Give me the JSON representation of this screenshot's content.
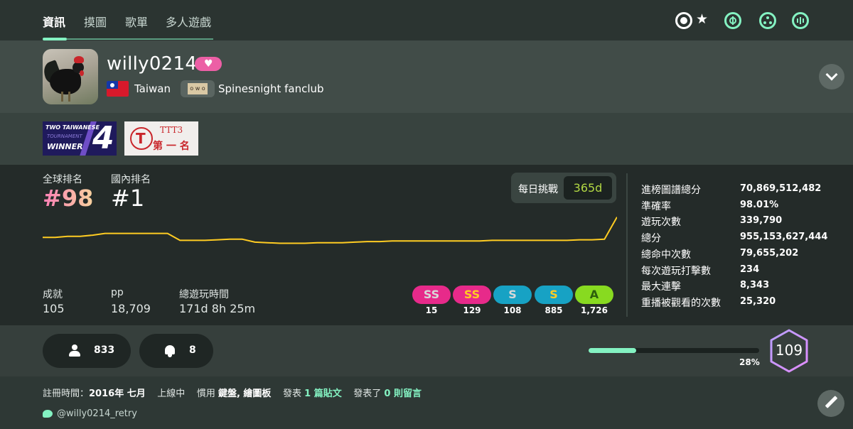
{
  "nav": {
    "tabs": [
      {
        "label": "資訊",
        "active": true
      },
      {
        "label": "摸圖",
        "active": false
      },
      {
        "label": "歌單",
        "active": false
      },
      {
        "label": "多人遊戲",
        "active": false
      }
    ],
    "modes": [
      "osu-standard-icon",
      "star-icon",
      "taiko-icon",
      "catch-icon",
      "mania-icon"
    ]
  },
  "profile": {
    "username": "willy0214",
    "country": "Taiwan",
    "team_flag_text": "o w o",
    "team": "Spinesnight fanclub"
  },
  "badges": {
    "badge1": {
      "line1": "TWO TAIWANESE",
      "line2": "TOURNAMENT",
      "line3": "WINNER",
      "number": "4"
    },
    "badge2": {
      "logo": "T",
      "title": "TTT3",
      "subtitle": "第 一 名"
    }
  },
  "ranks": {
    "global_label": "全球排名",
    "global_value": "#98",
    "country_label": "國內排名",
    "country_value": "#1"
  },
  "daily": {
    "label": "每日挑戰",
    "value": "365d"
  },
  "chart_data": {
    "type": "line",
    "description_free": true,
    "values": [
      63,
      63,
      65,
      65,
      67,
      70,
      70,
      70,
      70,
      70,
      70,
      58,
      58,
      58,
      59,
      60,
      60,
      55,
      54,
      53,
      53,
      53,
      54,
      54,
      54,
      55,
      56,
      56,
      57,
      57,
      57,
      57,
      57,
      57,
      57,
      57,
      58,
      58,
      58,
      58,
      58,
      58,
      58,
      59,
      59,
      60,
      98
    ],
    "color": "#ffcc22"
  },
  "summary": {
    "medals_label": "成就",
    "medals_value": "105",
    "pp_label": "pp",
    "pp_value": "18,709",
    "playtime_label": "總遊玩時間",
    "playtime_value": "171d 8h 25m"
  },
  "grades": [
    {
      "label": "SS",
      "count": "15",
      "bg": "#e72a8a",
      "fg": "#d8d8d8"
    },
    {
      "label": "SS",
      "count": "129",
      "bg": "#e72a8a",
      "fg": "#ffcc22"
    },
    {
      "label": "S",
      "count": "108",
      "bg": "#17a2c4",
      "fg": "#d8d8d8"
    },
    {
      "label": "S",
      "count": "885",
      "bg": "#17a2c4",
      "fg": "#ffcc22"
    },
    {
      "label": "A",
      "count": "1,726",
      "bg": "#88da20",
      "fg": "#2c5f0c"
    }
  ],
  "stats": [
    {
      "label": "進榜圖譜總分",
      "value": "70,869,512,482"
    },
    {
      "label": "準確率",
      "value": "98.01%"
    },
    {
      "label": "遊玩次數",
      "value": "339,790"
    },
    {
      "label": "總分",
      "value": "955,153,627,444"
    },
    {
      "label": "總命中次數",
      "value": "79,655,202"
    },
    {
      "label": "每次遊玩打擊數",
      "value": "234"
    },
    {
      "label": "最大連擊",
      "value": "8,343"
    },
    {
      "label": "重播被觀看的次數",
      "value": "25,320"
    }
  ],
  "social": {
    "followers": "833",
    "subscribers": "8"
  },
  "level": {
    "value": "109",
    "progress_percent": 28,
    "progress_label": "28%"
  },
  "footer": {
    "joined_label": "註冊時間：",
    "joined_value": "2016年 七月",
    "status": "上線中",
    "uses_label": "慣用",
    "uses_value": "鍵盤, 繪圖板",
    "posts_prefix": "發表",
    "posts_count": "1",
    "posts_suffix": "篇貼文",
    "comments_prefix": "發表了",
    "comments_count": "0",
    "comments_suffix": "則留言",
    "twitter": "@willy0214_retry"
  },
  "colors": {
    "accent": "#84f2c2",
    "supporter": "#ec5fa5",
    "chart_line": "#ffcc22"
  }
}
